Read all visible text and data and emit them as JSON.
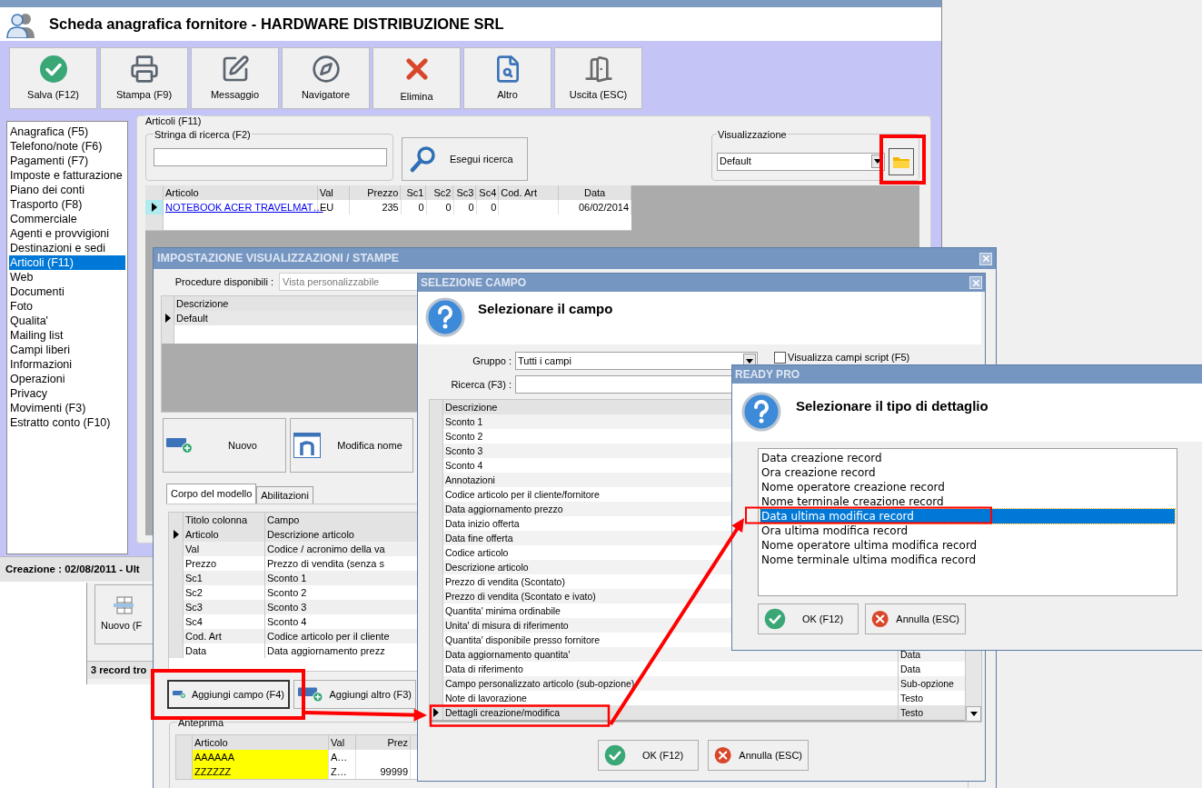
{
  "main_window": {
    "title": "Scheda anagrafica fornitore - HARDWARE DISTRIBUZIONE SRL",
    "toolbar": [
      "Salva (F12)",
      "Stampa (F9)",
      "Messaggio",
      "Navigatore",
      "Elimina",
      "Altro",
      "Uscita (ESC)"
    ],
    "sidebar": [
      {
        "label": "Anagrafica (F5)",
        "selected": false
      },
      {
        "label": "Telefono/note (F6)",
        "selected": false
      },
      {
        "label": "Pagamenti (F7)",
        "selected": false
      },
      {
        "label": "Imposte e fatturazione",
        "selected": false
      },
      {
        "label": "Piano dei conti",
        "selected": false
      },
      {
        "label": "Trasporto (F8)",
        "selected": false
      },
      {
        "label": "Commerciale",
        "selected": false
      },
      {
        "label": "Agenti e provvigioni",
        "selected": false
      },
      {
        "label": "Destinazioni e sedi",
        "selected": false
      },
      {
        "label": "Articoli (F11)",
        "selected": true
      },
      {
        "label": "Web",
        "selected": false
      },
      {
        "label": "Documenti",
        "selected": false
      },
      {
        "label": "Foto",
        "selected": false
      },
      {
        "label": "Qualita'",
        "selected": false
      },
      {
        "label": "Mailing list",
        "selected": false
      },
      {
        "label": "Campi liberi",
        "selected": false
      },
      {
        "label": "Informazioni",
        "selected": false
      },
      {
        "label": "Operazioni",
        "selected": false
      },
      {
        "label": "Privacy",
        "selected": false
      },
      {
        "label": "Movimenti (F3)",
        "selected": false
      },
      {
        "label": "Estratto conto (F10)",
        "selected": false
      }
    ],
    "panel_title": "Articoli (F11)",
    "search": {
      "legend": "Stringa di ricerca (F2)",
      "button": "Esegui ricerca"
    },
    "view": {
      "legend": "Visualizzazione",
      "value": "Default"
    },
    "table": {
      "columns": [
        "Articolo",
        "Val",
        "Prezzo",
        "Sc1",
        "Sc2",
        "Sc3",
        "Sc4",
        "Cod. Art",
        "Data"
      ],
      "rows": [
        {
          "cells": [
            "NOTEBOOK ACER TRAVELMAT…",
            "EU",
            "235",
            "0",
            "0",
            "0",
            "0",
            null,
            "06/02/2014"
          ],
          "selected": true
        }
      ]
    },
    "status": "Creazione : 02/08/2011 - Ult"
  },
  "back_window": {
    "button": "Nuovo (F",
    "status": "3 record tro"
  },
  "layout_dialog": {
    "title": "IMPOSTAZIONE VISUALIZZAZIONI / STAMPE",
    "procedure_label": "Procedure disponibili :",
    "procedure_value": "Vista personalizzabile",
    "models": {
      "column": "Descrizione",
      "rows": [
        {
          "label": "Default",
          "selected": true
        }
      ]
    },
    "buttons": [
      "Nuovo",
      "Modifica nome"
    ],
    "tabs": [
      {
        "label": "Corpo del modello",
        "selected": true
      },
      {
        "label": "Abilitazioni",
        "selected": false
      }
    ],
    "columns_grid": {
      "columns": [
        "Titolo colonna",
        "Campo"
      ],
      "rows": [
        {
          "title": "Articolo",
          "field": "Descrizione articolo",
          "selected": true
        },
        {
          "title": "Val",
          "field": "Codice / acronimo della va",
          "selected": false
        },
        {
          "title": "Prezzo",
          "field": "Prezzo di vendita (senza s",
          "selected": false
        },
        {
          "title": "Sc1",
          "field": "Sconto 1",
          "selected": false
        },
        {
          "title": "Sc2",
          "field": "Sconto 2",
          "selected": false
        },
        {
          "title": "Sc3",
          "field": "Sconto 3",
          "selected": false
        },
        {
          "title": "Sc4",
          "field": "Sconto 4",
          "selected": false
        },
        {
          "title": "Cod. Art",
          "field": "Codice articolo per il cliente",
          "selected": false
        },
        {
          "title": "Data",
          "field": "Data aggiornamento prezz",
          "selected": false
        }
      ]
    },
    "add_buttons": [
      "Aggiungi campo (F4)",
      "Aggiungi altro (F3)"
    ],
    "preview": {
      "legend": "Anteprima",
      "columns": [
        "Articolo",
        "Val",
        "Prez"
      ],
      "rows": [
        [
          "AAAAAA",
          "A…",
          null
        ],
        [
          "ZZZZZZ",
          "Z…",
          "99999"
        ]
      ]
    }
  },
  "field_dialog": {
    "title": "SELEZIONE CAMPO",
    "heading": "Selezionare il campo",
    "group_label": "Gruppo :",
    "group_value": "Tutti i campi",
    "script_checkbox": {
      "label": "Visualizza campi script (F5)",
      "checked": false
    },
    "search_label": "Ricerca (F3) :",
    "column": "Descrizione",
    "rows": [
      {
        "label": "Sconto 1",
        "selected": false
      },
      {
        "label": "Sconto 2",
        "selected": false
      },
      {
        "label": "Sconto 3",
        "selected": false
      },
      {
        "label": "Sconto 4",
        "selected": false
      },
      {
        "label": "Annotazioni",
        "selected": false
      },
      {
        "label": "Codice articolo per il cliente/fornitore",
        "selected": false
      },
      {
        "label": "Data aggiornamento prezzo",
        "selected": false
      },
      {
        "label": "Data inizio offerta",
        "selected": false
      },
      {
        "label": "Data fine offerta",
        "selected": false
      },
      {
        "label": "Codice articolo",
        "selected": false
      },
      {
        "label": "Descrizione articolo",
        "selected": false
      },
      {
        "label": "Prezzo di vendita (Scontato)",
        "selected": false
      },
      {
        "label": "Prezzo di vendita (Scontato e ivato)",
        "selected": false
      },
      {
        "label": "Quantita' minima ordinabile",
        "selected": false
      },
      {
        "label": "Unita' di misura di riferimento",
        "selected": false
      },
      {
        "label": "Quantita' disponibile presso fornitore",
        "selected": false
      },
      {
        "label": "Data aggiornamento quantita'",
        "type": "Data",
        "selected": false
      },
      {
        "label": "Data di riferimento",
        "type": "Data",
        "selected": false
      },
      {
        "label": "Campo personalizzato articolo (sub-opzione)",
        "type": "Sub-opzione",
        "selected": false
      },
      {
        "label": "Note di lavorazione",
        "type": "Testo",
        "selected": false
      },
      {
        "label": "Dettagli creazione/modifica",
        "type": "Testo",
        "selected": true
      }
    ],
    "buttons": [
      {
        "label": "OK (F12)",
        "kind": "ok"
      },
      {
        "label": "Annulla (ESC)",
        "kind": "cancel"
      }
    ]
  },
  "detail_dialog": {
    "title": "READY PRO",
    "heading": "Selezionare il tipo di dettaglio",
    "options": [
      {
        "label": "Data creazione record",
        "selected": false
      },
      {
        "label": "Ora creazione record",
        "selected": false
      },
      {
        "label": "Nome operatore creazione record",
        "selected": false
      },
      {
        "label": "Nome terminale creazione record",
        "selected": false
      },
      {
        "label": "Data ultima modifica record",
        "selected": true
      },
      {
        "label": "Ora ultima modifica record",
        "selected": false
      },
      {
        "label": "Nome operatore ultima modifica record",
        "selected": false
      },
      {
        "label": "Nome terminale ultima modifica record",
        "selected": false
      }
    ],
    "buttons": [
      {
        "label": "OK (F12)",
        "kind": "ok"
      },
      {
        "label": "Annulla (ESC)",
        "kind": "cancel"
      }
    ]
  }
}
